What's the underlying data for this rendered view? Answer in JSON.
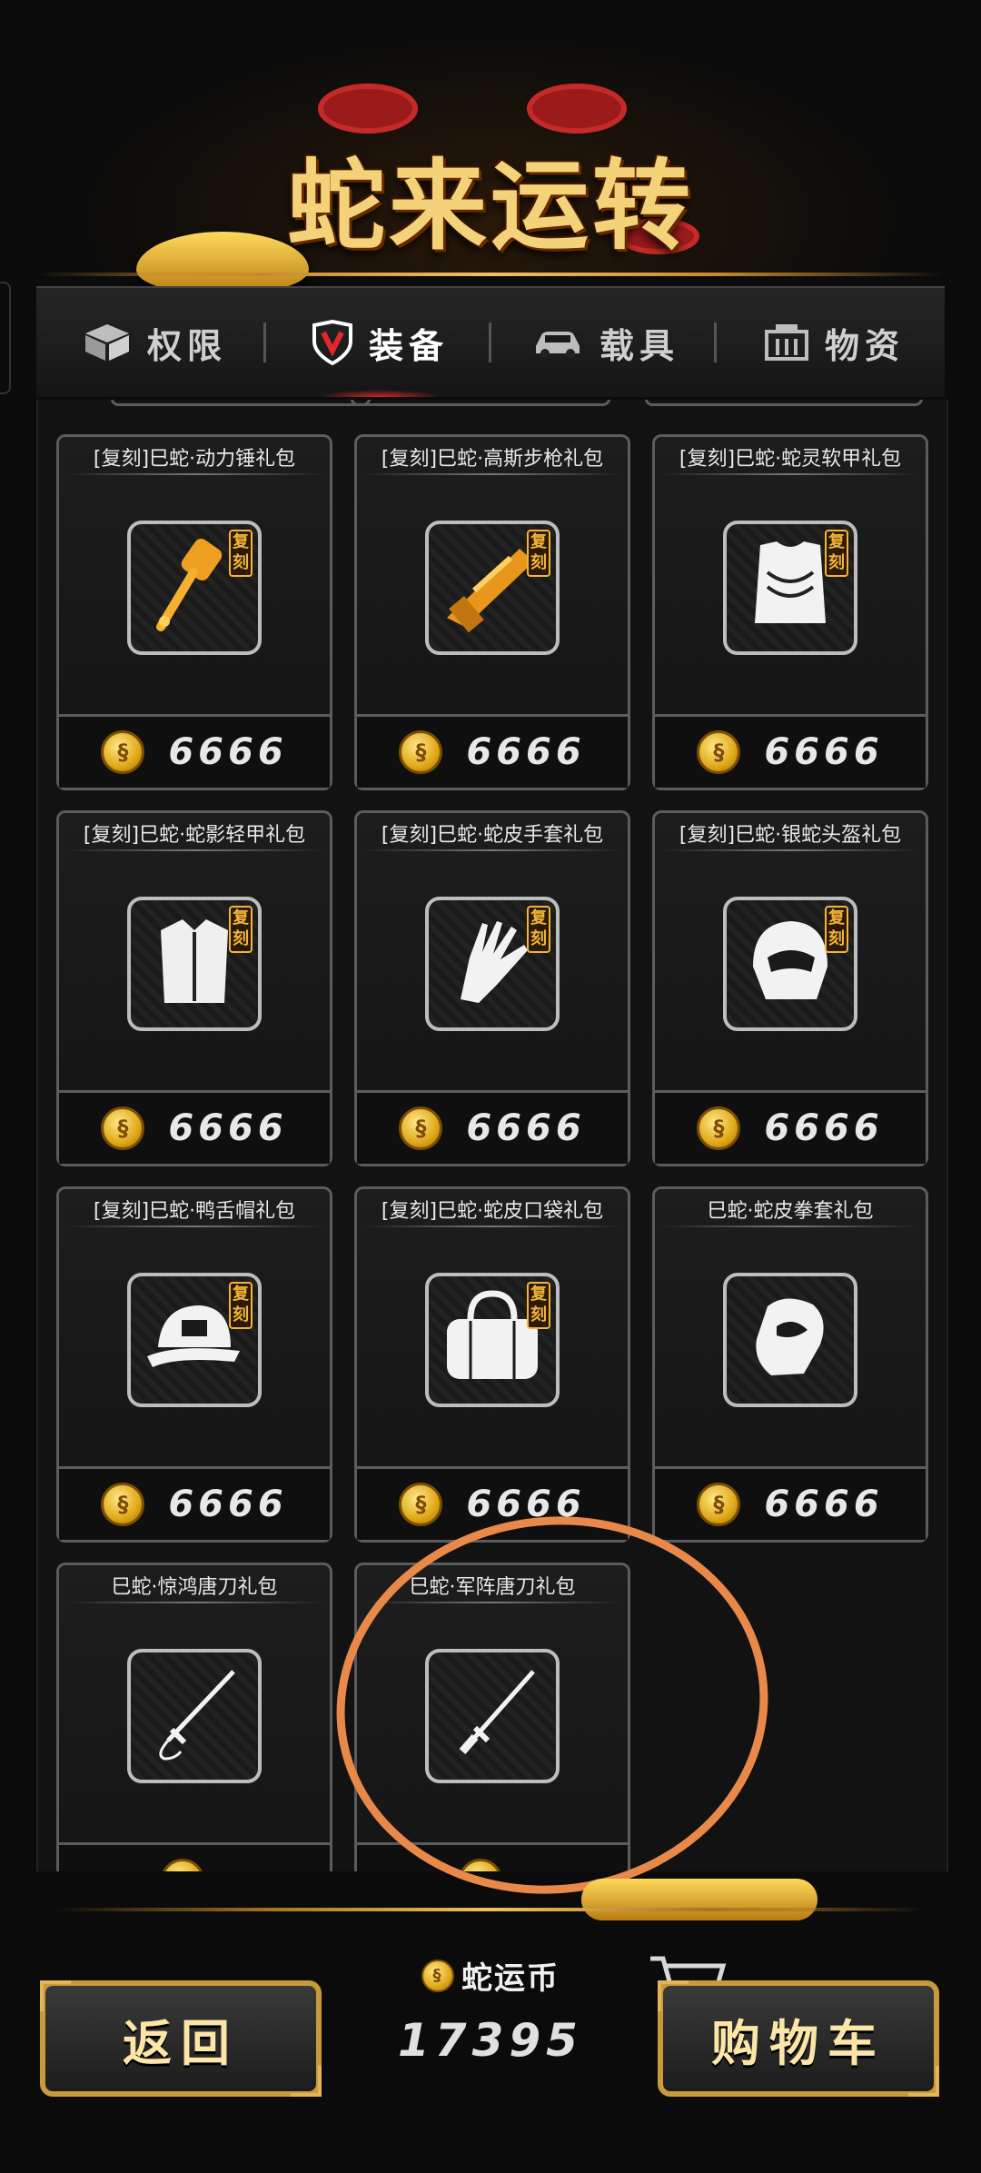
{
  "header": {
    "title": "蛇来运转"
  },
  "tabs": [
    {
      "label": "权限",
      "icon": "box-icon",
      "active": false
    },
    {
      "label": "装备",
      "icon": "shield-icon",
      "active": true
    },
    {
      "label": "载具",
      "icon": "car-icon",
      "active": false
    },
    {
      "label": "物资",
      "icon": "crate-icon",
      "active": false
    }
  ],
  "items": [
    {
      "title": "[复刻]巳蛇·动力锤礼包",
      "icon": "power-hammer-icon",
      "badge": "复刻",
      "price": "6666"
    },
    {
      "title": "[复刻]巳蛇·高斯步枪礼包",
      "icon": "gauss-rifle-icon",
      "badge": "复刻",
      "price": "6666"
    },
    {
      "title": "[复刻]巳蛇·蛇灵软甲礼包",
      "icon": "soft-armor-icon",
      "badge": "复刻",
      "price": "6666"
    },
    {
      "title": "[复刻]巳蛇·蛇影轻甲礼包",
      "icon": "light-armor-icon",
      "badge": "复刻",
      "price": "6666"
    },
    {
      "title": "[复刻]巳蛇·蛇皮手套礼包",
      "icon": "gloves-icon",
      "badge": "复刻",
      "price": "6666"
    },
    {
      "title": "[复刻]巳蛇·银蛇头盔礼包",
      "icon": "helmet-icon",
      "badge": "复刻",
      "price": "6666"
    },
    {
      "title": "[复刻]巳蛇·鸭舌帽礼包",
      "icon": "cap-icon",
      "badge": "复刻",
      "price": "6666"
    },
    {
      "title": "[复刻]巳蛇·蛇皮口袋礼包",
      "icon": "bag-icon",
      "badge": "复刻",
      "price": "6666"
    },
    {
      "title": "巳蛇·蛇皮拳套礼包",
      "icon": "boxing-glove-icon",
      "badge": "",
      "price": "6666"
    },
    {
      "title": "巳蛇·惊鸿唐刀礼包",
      "icon": "tang-sword-icon",
      "badge": "",
      "price": ""
    },
    {
      "title": "巳蛇·军阵唐刀礼包",
      "icon": "tang-sword-icon",
      "badge": "",
      "price": ""
    }
  ],
  "footer": {
    "back_label": "返回",
    "currency_label": "蛇运币",
    "currency_amount": "17395",
    "cart_label": "购物车"
  },
  "colors": {
    "accent_gold": "#f4d27a",
    "badge_orange": "#f4b43a",
    "highlight_ring": "#e8894a"
  }
}
